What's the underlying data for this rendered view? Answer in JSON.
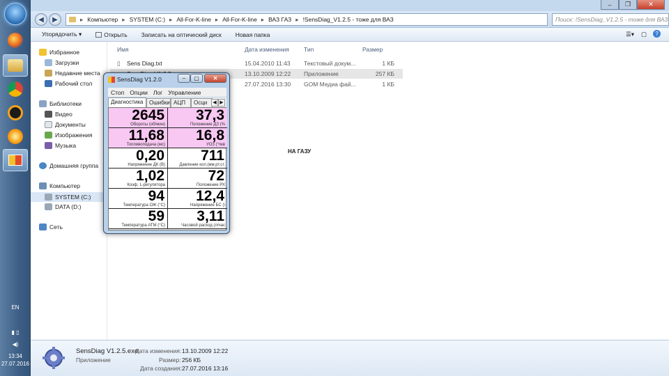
{
  "taskbar": {
    "lang": "EN",
    "time": "13:34",
    "date": "27.07.2016"
  },
  "address": {
    "crumbs": [
      "Компьютер",
      "SYSTEM (C:)",
      "All-For-K-line",
      "All-For-K-line",
      "ВАЗ ГАЗ",
      "!SensDiag_V1.2.5 - тоже для ВАЗ"
    ],
    "search_placeholder": "Поиск: !SensDiag_V1.2.5 - тоже для ВАЗ"
  },
  "commands": {
    "organize": "Упорядочить",
    "open": "Открыть",
    "burn": "Записать на оптический диск",
    "new_folder": "Новая папка"
  },
  "nav": {
    "favorites": "Избранное",
    "downloads": "Загрузки",
    "recent": "Недавние места",
    "desktop": "Рабочий стол",
    "libraries": "Библиотеки",
    "video": "Видео",
    "documents": "Документы",
    "images": "Изображения",
    "music": "Музыка",
    "homegroup": "Домашняя группа",
    "computer": "Компьютер",
    "system_c": "SYSTEM (C:)",
    "data_d": "DATA (D:)",
    "network": "Сеть"
  },
  "columns": {
    "name": "Имя",
    "date": "Дата изменения",
    "type": "Тип",
    "size": "Размер"
  },
  "files": [
    {
      "name": "Sens Diag.txt",
      "date": "15.04.2010 11:43",
      "type": "Текстовый докум...",
      "size": "1 КБ"
    },
    {
      "name": "SensDiag V1.2.5.exe",
      "date": "13.10.2009 12:22",
      "type": "Приложение",
      "size": "257 КБ"
    },
    {
      "name": "",
      "date": "27.07.2016 13:30",
      "type": "GOM Медиа фай...",
      "size": "1 КБ"
    }
  ],
  "note": "НА ГАЗУ",
  "details": {
    "filename": "SensDiag V1.2.5.exe",
    "kind": "Приложение",
    "modified_label": "Дата изменения:",
    "modified": "13.10.2009 12:22",
    "size_label": "Размер:",
    "size": "256 КБ",
    "created_label": "Дата создания:",
    "created": "27.07.2016 13:16"
  },
  "sensdiag": {
    "title": "SensDiag V1.2.0",
    "menu": [
      "Стоп",
      "Опции",
      "Лог",
      "Управление"
    ],
    "tabs": [
      "Диагностика",
      "Ошибки",
      "АЦП",
      "Осци"
    ],
    "cells": [
      {
        "value": "2645",
        "label": "Обороты (об/мин)",
        "highlight": true
      },
      {
        "value": "37,3",
        "label": "Положение ДЗ (%",
        "highlight": true
      },
      {
        "value": "11,68",
        "label": "Топливоподача (мс)",
        "highlight": true
      },
      {
        "value": "16,8",
        "label": "УОЗ (°пкв",
        "highlight": true
      },
      {
        "value": "0,20",
        "label": "Напряжение ДК (В)",
        "highlight": false
      },
      {
        "value": "711",
        "label": "Давление кол.(мм.рт.ст.",
        "highlight": false
      },
      {
        "value": "1,02",
        "label": "Коэф. L-регулятора",
        "highlight": false
      },
      {
        "value": "72",
        "label": "Положение РХ",
        "highlight": false
      },
      {
        "value": "94",
        "label": "Температура ОЖ (°С)",
        "highlight": false
      },
      {
        "value": "12,4",
        "label": "Напряжение БС (\\",
        "highlight": false
      },
      {
        "value": "59",
        "label": "Температура АТМ (°С)",
        "highlight": false
      },
      {
        "value": "3,11",
        "label": "Часовой расход (л/час",
        "highlight": false
      }
    ]
  },
  "colors": {
    "highlight": "#f8c8f2",
    "taskbar": "#3e6087",
    "selection": "#d9e6f5"
  }
}
